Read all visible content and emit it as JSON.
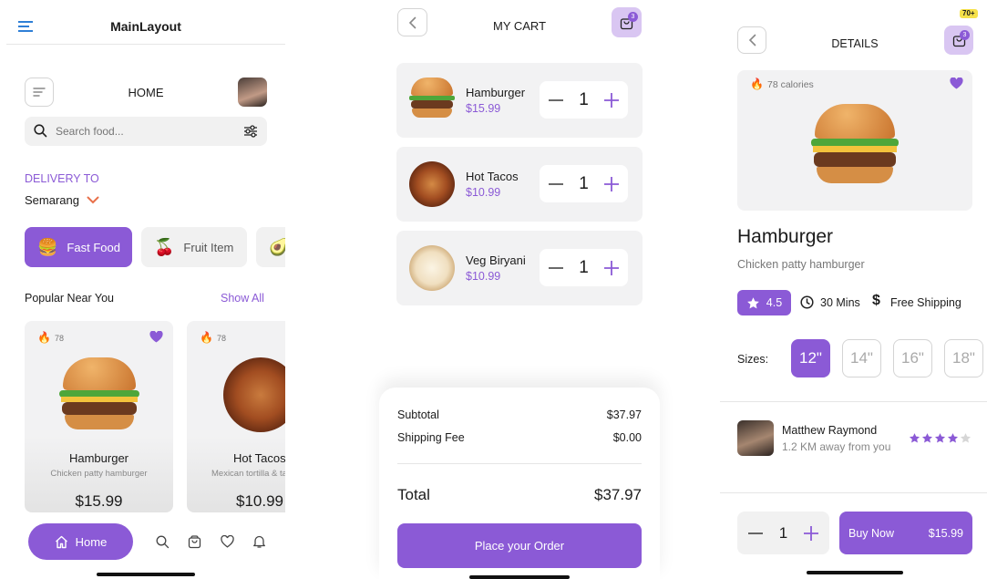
{
  "colors": {
    "accent": "#8b5ad6",
    "accent_light": "#d9c6f2",
    "card": "#f2f2f3"
  },
  "home": {
    "layout_title": "MainLayout",
    "title": "HOME",
    "search_placeholder": "Search food...",
    "delivery_label": "DELIVERY TO",
    "location": "Semarang",
    "categories": [
      {
        "label": "Fast Food",
        "emoji": "🍔"
      },
      {
        "label": "Fruit Item",
        "emoji": "🍒"
      },
      {
        "label": "",
        "emoji": "🥑"
      }
    ],
    "popular_label": "Popular Near You",
    "show_all": "Show All",
    "products": [
      {
        "name": "Hamburger",
        "desc": "Chicken patty hamburger",
        "price": "$15.99",
        "calories": "78"
      },
      {
        "name": "Hot Tacos",
        "desc": "Mexican tortilla & tacos",
        "price": "$10.99",
        "calories": "78"
      }
    ],
    "nav": {
      "home": "Home"
    }
  },
  "cart": {
    "title": "MY CART",
    "badge": "3",
    "items": [
      {
        "name": "Hamburger",
        "price": "$15.99",
        "qty": "1"
      },
      {
        "name": "Hot Tacos",
        "price": "$10.99",
        "qty": "1"
      },
      {
        "name": "Veg Biryani",
        "price": "$10.99",
        "qty": "1"
      }
    ],
    "subtotal_label": "Subtotal",
    "subtotal": "$37.97",
    "shipping_label": "Shipping Fee",
    "shipping": "$0.00",
    "total_label": "Total",
    "total": "$37.97",
    "order_button": "Place your Order"
  },
  "details": {
    "title": "DETAILS",
    "badge": "3",
    "top_badge": "70+",
    "calories": "78 calories",
    "name": "Hamburger",
    "desc": "Chicken patty hamburger",
    "rating": "4.5",
    "time": "30 Mins",
    "shipping": "Free Shipping",
    "sizes_label": "Sizes:",
    "sizes": [
      "12\"",
      "14\"",
      "16\"",
      "18\""
    ],
    "selected_size": "12\"",
    "seller": {
      "name": "Matthew Raymond",
      "distance": "1.2 KM away from you",
      "stars": 4
    },
    "qty": "1",
    "buy_label": "Buy Now",
    "buy_price": "$15.99"
  }
}
